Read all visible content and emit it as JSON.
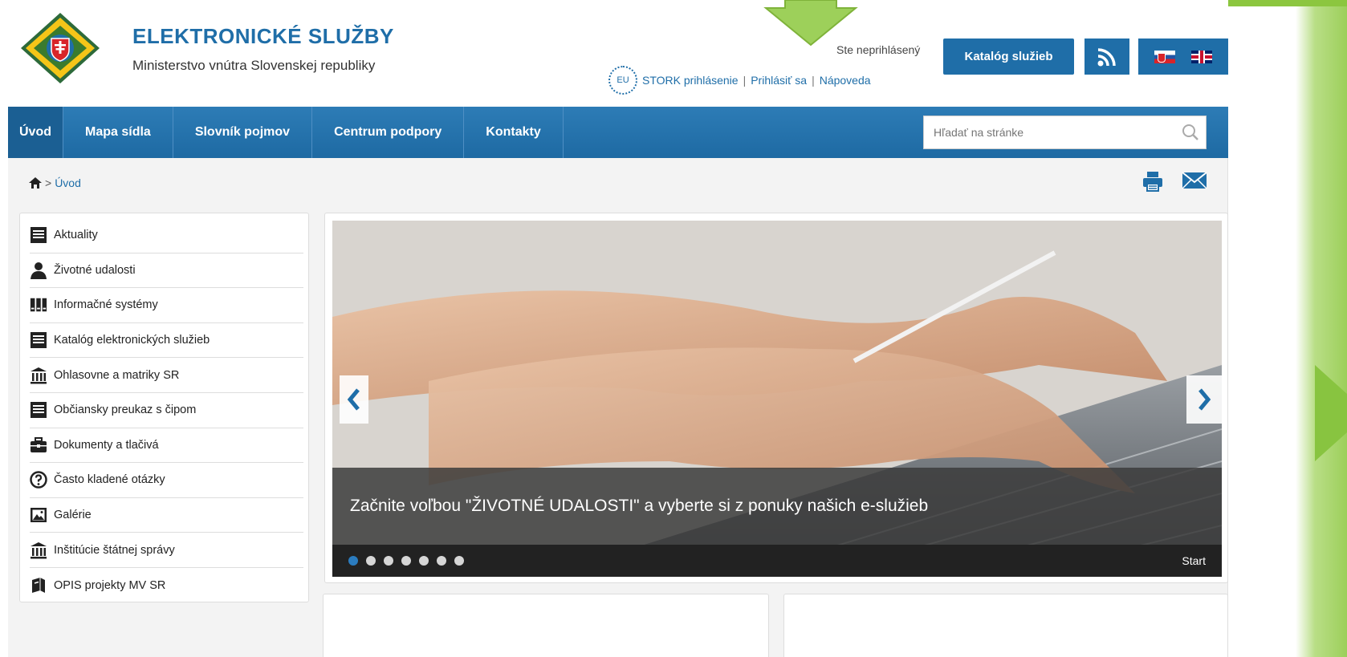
{
  "header": {
    "title": "ELEKTRONICKÉ SLUŽBY",
    "subtitle": "Ministerstvo vnútra Slovenskej republiky",
    "login_status": "Ste neprihlásený",
    "eu_badge": "EU",
    "stork_login": "STORK prihlásenie",
    "login": "Prihlásiť sa",
    "help": "Nápoveda",
    "catalog_button": "Katalóg služieb",
    "rss_icon": "rss-icon",
    "languages": [
      "sk",
      "en"
    ]
  },
  "nav": {
    "items": [
      {
        "label": "Úvod",
        "active": true
      },
      {
        "label": "Mapa sídla"
      },
      {
        "label": "Slovník pojmov"
      },
      {
        "label": "Centrum podpory"
      },
      {
        "label": "Kontakty"
      }
    ],
    "search_placeholder": "Hľadať na stránke"
  },
  "breadcrumb": {
    "separator": ">",
    "current": "Úvod"
  },
  "sidebar": {
    "items": [
      {
        "label": "Aktuality",
        "icon": "document-icon"
      },
      {
        "label": "Životné udalosti",
        "icon": "person-icon"
      },
      {
        "label": "Informačné systémy",
        "icon": "servers-icon"
      },
      {
        "label": "Katalóg elektronických služieb",
        "icon": "document-icon"
      },
      {
        "label": "Ohlasovne a matriky SR",
        "icon": "institution-icon"
      },
      {
        "label": "Občiansky preukaz s čipom",
        "icon": "document-icon"
      },
      {
        "label": "Dokumenty a tlačivá",
        "icon": "briefcase-icon"
      },
      {
        "label": "Často kladené otázky",
        "icon": "question-icon"
      },
      {
        "label": "Galérie",
        "icon": "gallery-icon"
      },
      {
        "label": "Inštitúcie štátnej správy",
        "icon": "institution-icon"
      },
      {
        "label": "OPIS projekty MV SR",
        "icon": "book-icon"
      }
    ]
  },
  "slider": {
    "caption": "Začnite voľbou \"ŽIVOTNÉ UDALOSTI\" a vyberte si z ponuky našich e-služieb",
    "dot_count": 7,
    "active_dot": 1,
    "start_label": "Start"
  },
  "colors": {
    "brand_blue": "#1f6ea8",
    "accent_green": "#8cc63f"
  }
}
